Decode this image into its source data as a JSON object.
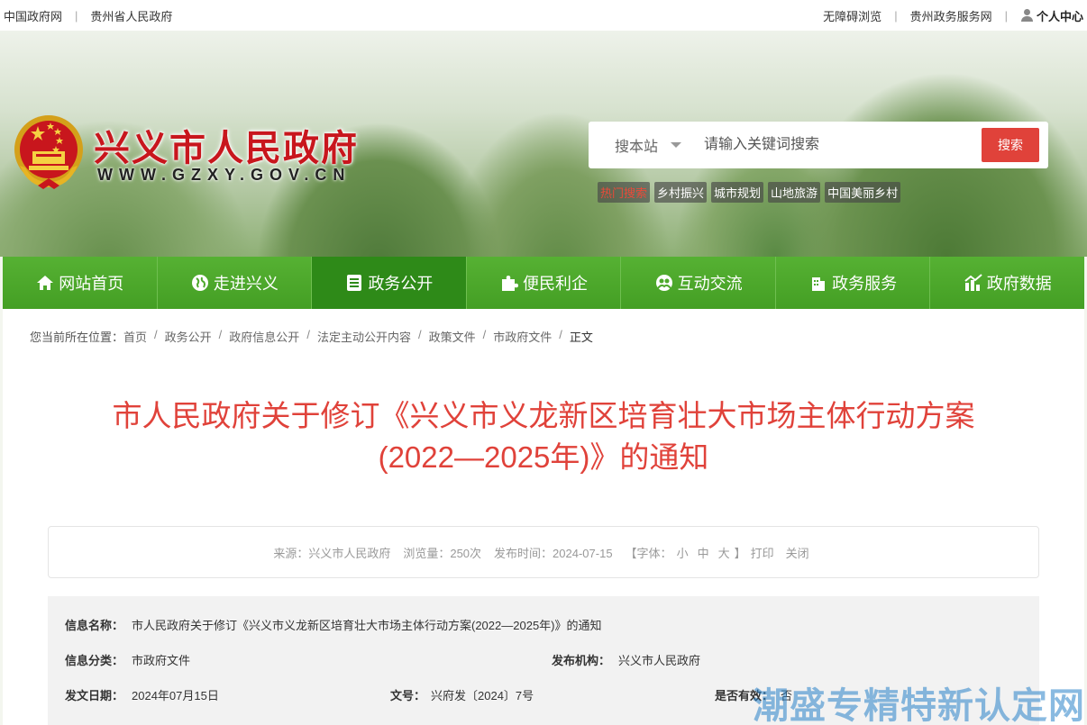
{
  "topbar": {
    "left_links": [
      "中国政府网",
      "贵州省人民政府"
    ],
    "right_links": [
      "无障碍浏览",
      "贵州政务服务网"
    ],
    "user_center": "个人中心"
  },
  "header": {
    "site_title": "兴义市人民政府",
    "site_url": "WWW.GZXY.GOV.CN"
  },
  "search": {
    "scope": "搜本站",
    "placeholder": "请输入关键词搜索",
    "button": "搜索",
    "hot_label": "热门搜索",
    "hot_words": [
      "乡村振兴",
      "城市规划",
      "山地旅游",
      "中国美丽乡村"
    ]
  },
  "nav": {
    "items": [
      "网站首页",
      "走进兴义",
      "政务公开",
      "便民利企",
      "互动交流",
      "政务服务",
      "政府数据"
    ],
    "active_index": 2
  },
  "breadcrumb": {
    "prefix": "您当前所在位置：",
    "items": [
      "首页",
      "政务公开",
      "政府信息公开",
      "法定主动公开内容",
      "政策文件",
      "市政府文件",
      "正文"
    ]
  },
  "article": {
    "title": "市人民政府关于修订《兴义市义龙新区培育壮大市场主体行动方案(2022—2025年)》的通知"
  },
  "meta": {
    "source": "来源：兴义市人民政府",
    "views": "浏览量：250次",
    "published": "发布时间：2024-07-15",
    "font_label": "【字体：",
    "font_small": "小",
    "font_medium": "中",
    "font_large": "大",
    "font_close": "】",
    "print": "打印",
    "close": "关闭"
  },
  "info": {
    "name_label": "信息名称：",
    "name_value": "市人民政府关于修订《兴义市义龙新区培育壮大市场主体行动方案(2022—2025年)》的通知",
    "category_label": "信息分类：",
    "category_value": "市政府文件",
    "org_label": "发布机构：",
    "org_value": "兴义市人民政府",
    "date_label": "发文日期：",
    "date_value": "2024年07月15日",
    "docno_label": "文号：",
    "docno_value": "兴府发〔2024〕7号",
    "valid_label": "是否有效：",
    "valid_value": "否"
  },
  "watermark": "潮盛专精特新认定网",
  "colors": {
    "brand_red": "#c8161d",
    "title_red": "#e0423a",
    "nav_green": "#4ea92c",
    "nav_active": "#2e8a18"
  }
}
